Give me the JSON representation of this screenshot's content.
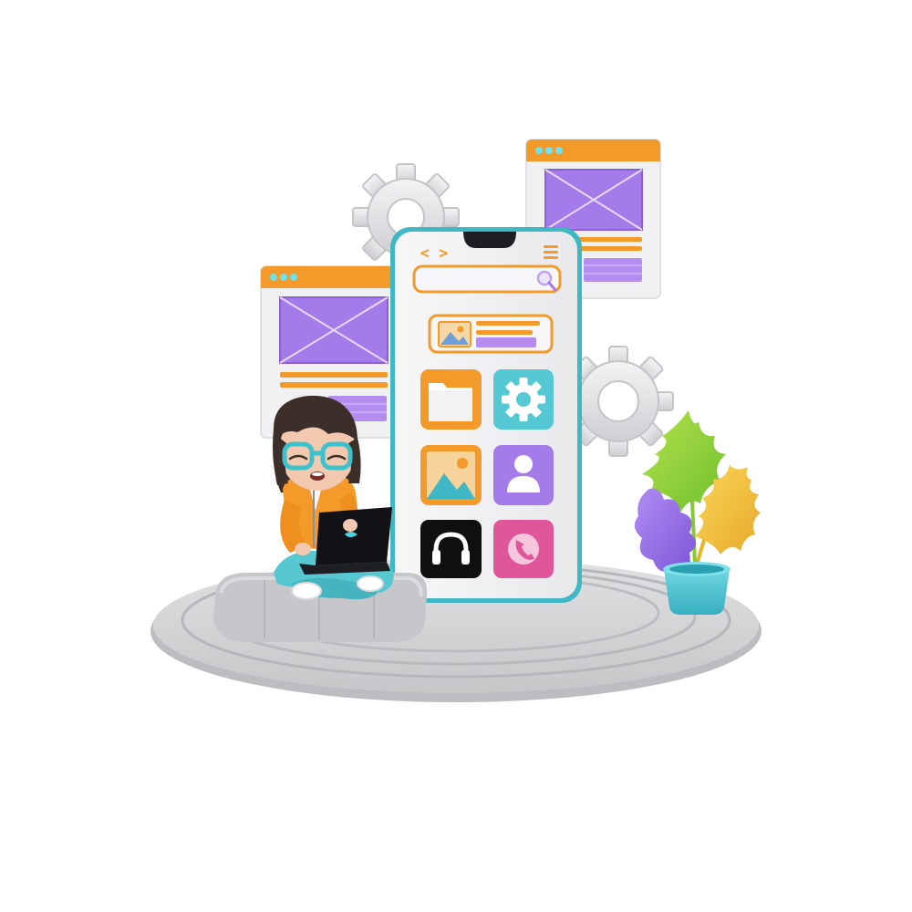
{
  "phone": {
    "header_symbol": "< >"
  },
  "colors": {
    "accent_orange": "#F39A2B",
    "accent_purple": "#A57BEA",
    "accent_cyan": "#55C9D3",
    "accent_pink": "#E0569A",
    "base_gray": "#D4D4D6",
    "plant_green": "#8BD23A",
    "plant_yellow": "#F2C53A"
  },
  "icons": [
    "folder-icon",
    "gear-icon",
    "image-icon",
    "user-icon",
    "headphones-icon",
    "phone-call-icon",
    "search-icon",
    "hamburger-menu-icon",
    "code-brackets-icon"
  ]
}
